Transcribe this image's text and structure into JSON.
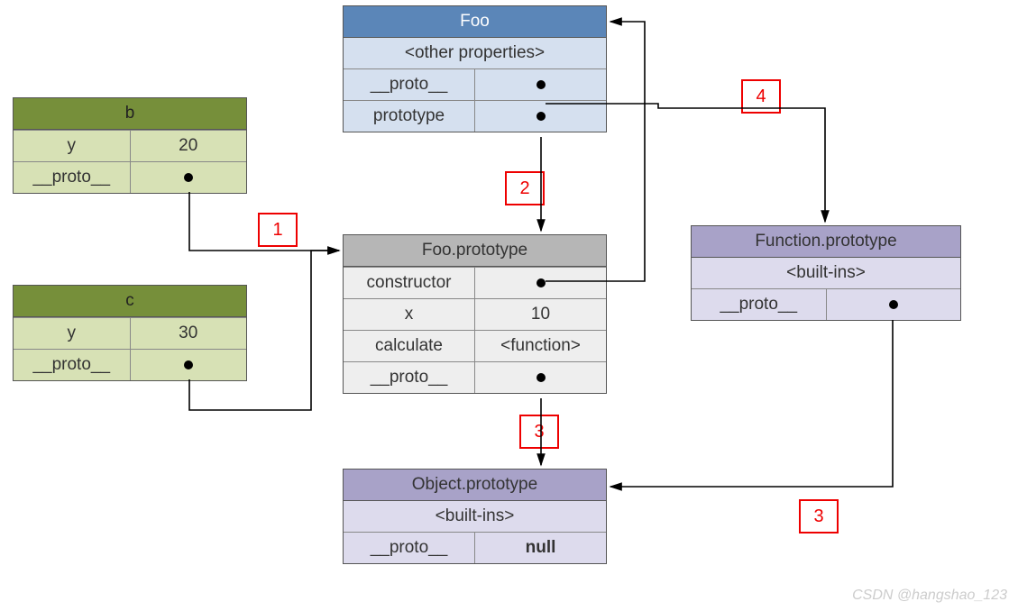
{
  "watermark": "CSDN @hangshao_123",
  "labels": {
    "1": "1",
    "2": "2",
    "3": "3",
    "4": "4"
  },
  "boxes": {
    "foo": {
      "title": "Foo",
      "other": "<other properties>",
      "proto": "__proto__",
      "prototype": "prototype"
    },
    "b": {
      "title": "b",
      "y_label": "y",
      "y_value": "20",
      "proto": "__proto__"
    },
    "c": {
      "title": "c",
      "y_label": "y",
      "y_value": "30",
      "proto": "__proto__"
    },
    "fooProto": {
      "title": "Foo.prototype",
      "constructor": "constructor",
      "x_label": "x",
      "x_value": "10",
      "calc_label": "calculate",
      "calc_value": "<function>",
      "proto": "__proto__"
    },
    "funcProto": {
      "title": "Function.prototype",
      "builtins": "<built-ins>",
      "proto": "__proto__"
    },
    "objProto": {
      "title": "Object.prototype",
      "builtins": "<built-ins>",
      "proto": "__proto__",
      "null": "null"
    }
  }
}
